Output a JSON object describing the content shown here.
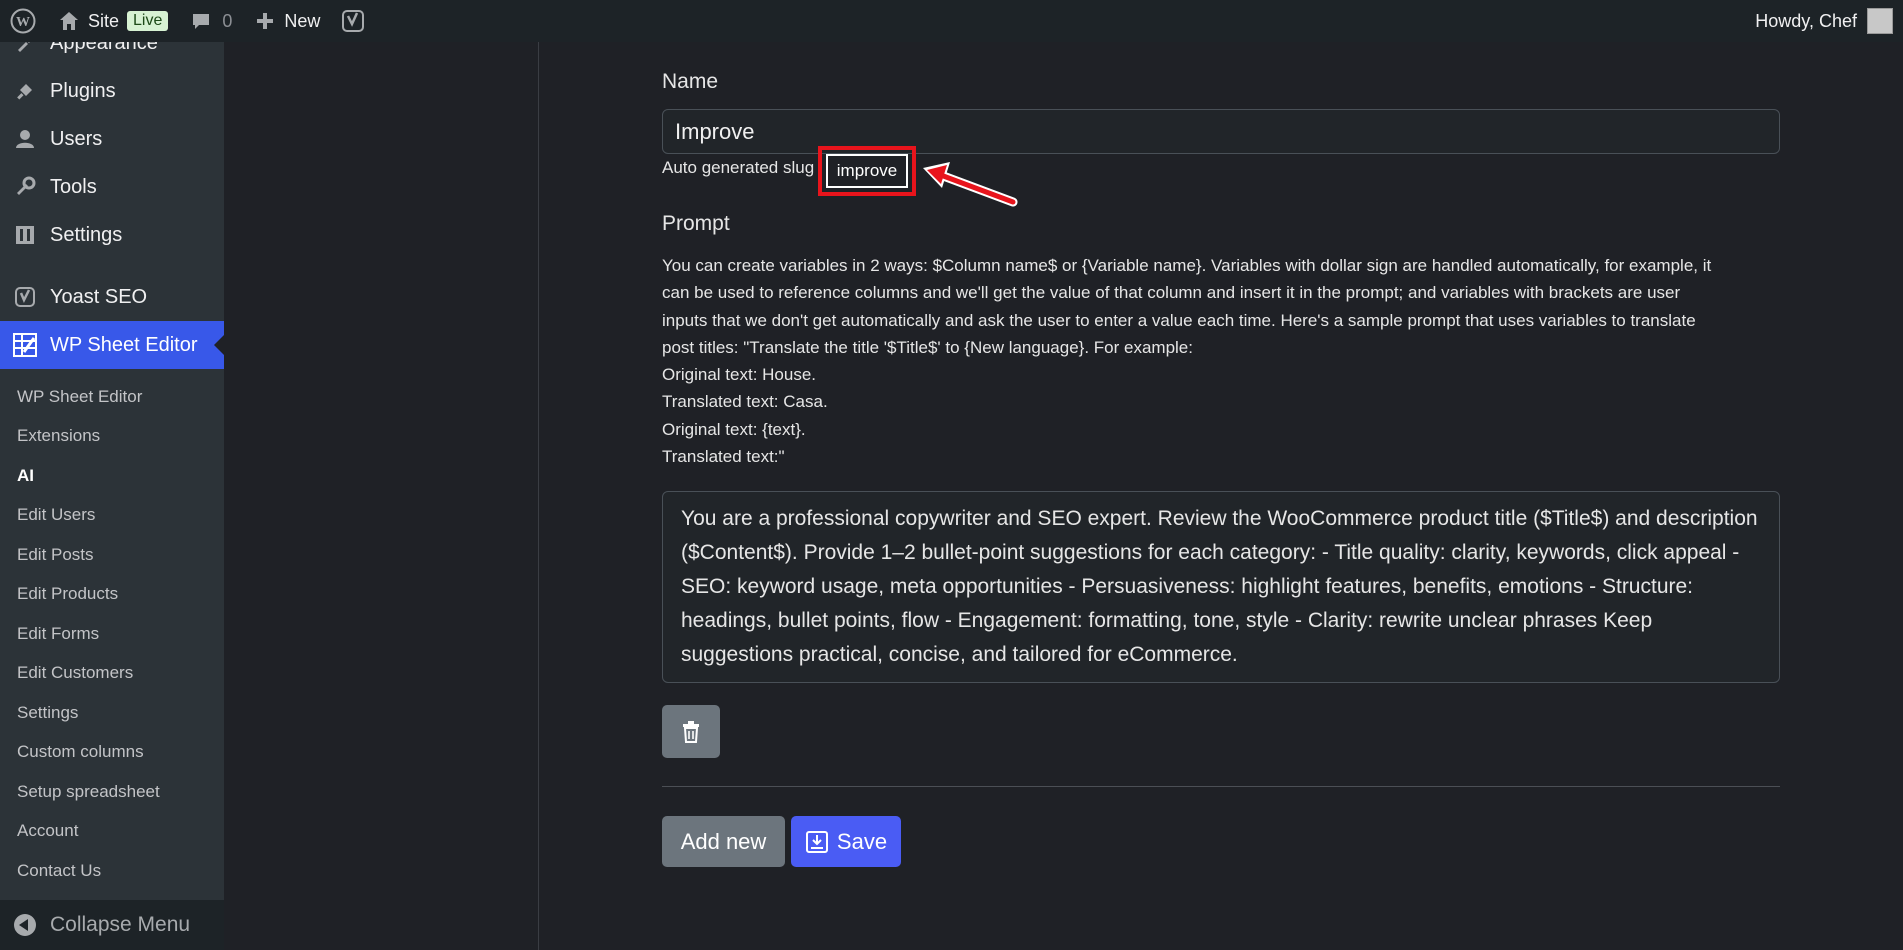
{
  "adminbar": {
    "site_label": "Site",
    "live_badge": "Live",
    "comments_count": "0",
    "new_label": "New",
    "howdy": "Howdy, Chef"
  },
  "sidebar": {
    "top_items": [
      {
        "label": "Appearance",
        "icon": "paintbrush-icon"
      },
      {
        "label": "Plugins",
        "icon": "plugin-icon"
      },
      {
        "label": "Users",
        "icon": "users-icon"
      },
      {
        "label": "Tools",
        "icon": "wrench-icon"
      },
      {
        "label": "Settings",
        "icon": "settings-icon"
      },
      {
        "label": "Yoast SEO",
        "icon": "yoast-icon"
      },
      {
        "label": "WP Sheet Editor",
        "icon": "spreadsheet-icon"
      }
    ],
    "sub_items": [
      "WP Sheet Editor",
      "Extensions",
      "AI",
      "Edit Users",
      "Edit Posts",
      "Edit Products",
      "Edit Forms",
      "Edit Customers",
      "Settings",
      "Custom columns",
      "Setup spreadsheet",
      "Account",
      "Contact Us"
    ],
    "collapse_label": "Collapse Menu"
  },
  "form": {
    "name_label": "Name",
    "name_value": "Improve",
    "slug_prefix": "Auto generated slug",
    "slug_value": "improve",
    "prompt_label": "Prompt",
    "help_lines": [
      "You can create variables in 2 ways: $Column name$ or {Variable name}. Variables with dollar sign are handled automatically, for example, it",
      "can be used to reference columns and we'll get the value of that column and insert it in the prompt; and variables with brackets are user",
      "inputs that we don't get automatically and ask the user to enter a value each time. Here's a sample prompt that uses variables to translate",
      "post titles: \"Translate the title '$Title$' to {New language}. For example:",
      "Original text: House.",
      "Translated text: Casa.",
      "Original text: {text}.",
      "Translated text:\""
    ],
    "prompt_value": "You are a professional copywriter and SEO expert. Review the WooCommerce product title ($Title$) and description ($Content$). Provide 1–2 bullet-point suggestions for each category: - Title quality: clarity, keywords, click appeal - SEO: keyword usage, meta opportunities - Persuasiveness: highlight features, benefits, emotions - Structure: headings, bullet points, flow - Engagement: formatting, tone, style - Clarity: rewrite unclear phrases Keep suggestions practical, concise, and tailored for eCommerce.",
    "add_new_label": "Add new",
    "save_label": "Save"
  },
  "colors": {
    "accent": "#3858e9",
    "save_button": "#4a5cf4",
    "highlight": "#e8141c"
  }
}
